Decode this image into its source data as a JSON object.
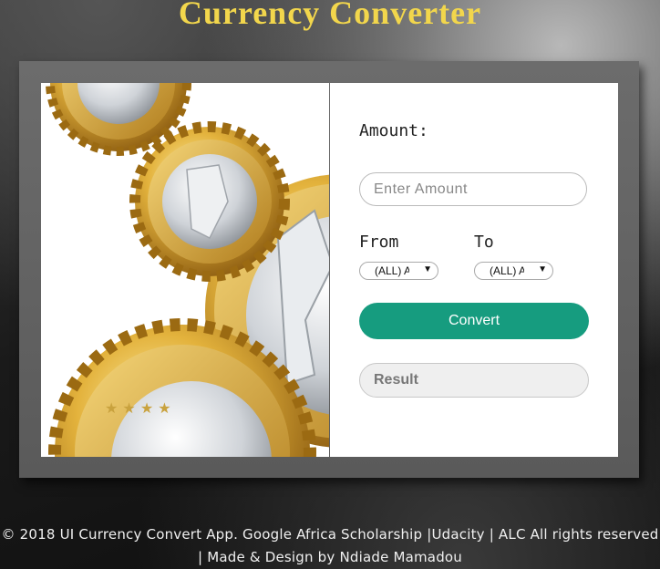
{
  "app": {
    "title": "Currency Converter"
  },
  "form": {
    "amount_label": "Amount:",
    "amount_placeholder": "Enter Amount",
    "amount_value": "",
    "from_label": "From",
    "to_label": "To",
    "from_selected": "(ALL) Albanian Lek",
    "to_selected": "(ALL) Albanian Lek",
    "convert_label": "Convert",
    "result_label": "Result"
  },
  "footer": {
    "line1": "© 2018 UI Currency Convert App. Google Africa Scholarship |Udacity | ALC All rights reserved",
    "line2": "| Made & Design by Ndiade Mamadou"
  },
  "colors": {
    "title": "#f2d64c",
    "convert_button": "#169c7f",
    "panel_bg": "#ffffff",
    "frame": "#5f5f5f"
  },
  "icons": {
    "select_arrow": "dropdown-arrow-icon"
  }
}
